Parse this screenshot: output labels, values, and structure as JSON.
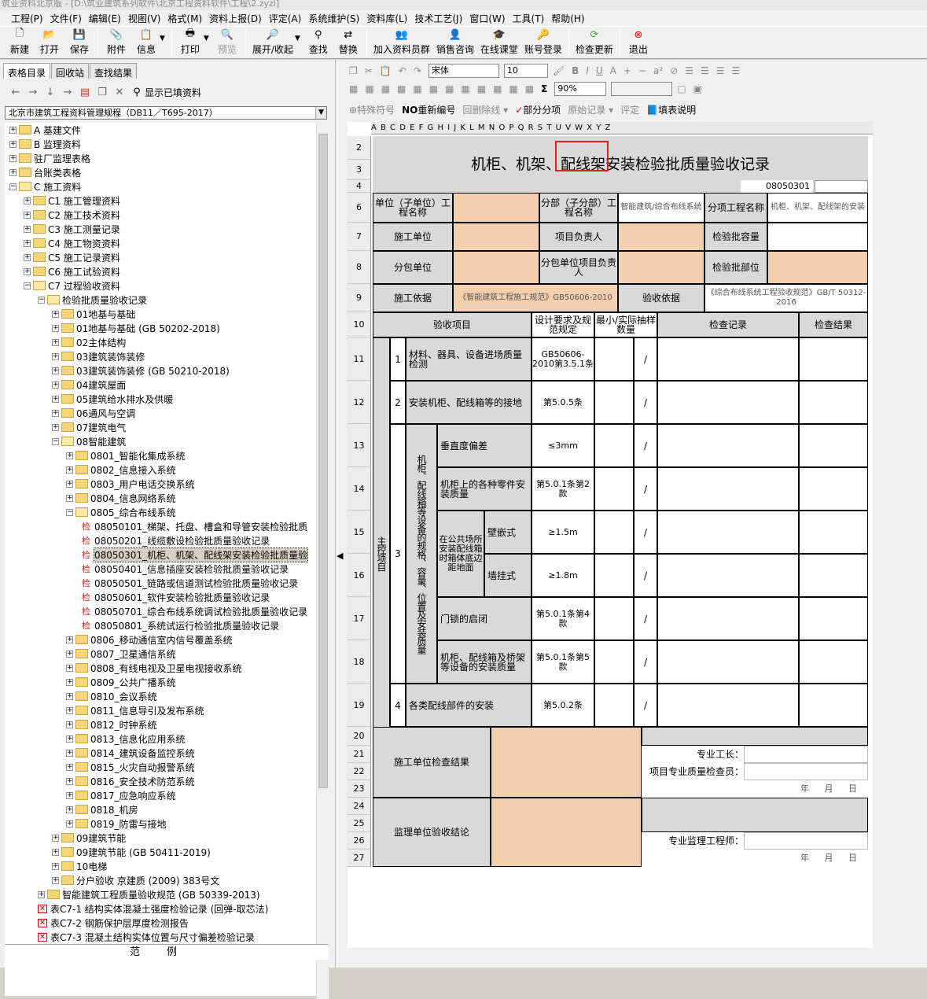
{
  "window_title": "筑业资料北京版 - [D:\\筑业建筑系列软件\\北京工程资料软件\\工程\\2.zyzl]",
  "menu": [
    "工程(P)",
    "文件(F)",
    "编辑(E)",
    "视图(V)",
    "格式(M)",
    "资料上报(D)",
    "评定(A)",
    "系统维护(S)",
    "资料库(L)",
    "技术工艺(J)",
    "窗口(W)",
    "工具(T)",
    "帮助(H)"
  ],
  "toolbar": [
    "新建",
    "打开",
    "保存",
    "附件",
    "信息",
    "打印",
    "预览",
    "展开/收起",
    "查找",
    "替换",
    "加入资料员群",
    "销售咨询",
    "在线课堂",
    "账号登录",
    "检查更新",
    "退出"
  ],
  "left_tabs": [
    "表格目录",
    "回收站",
    "查找结果"
  ],
  "show_filled": "显示已填资料",
  "spec_select": "北京市建筑工程资料管理规程（DB11／T695-2017）",
  "tree": [
    "A 基建文件",
    "B 监理资料",
    "驻厂监理表格",
    "台账类表格",
    "C 施工资料",
    "C1 施工管理资料",
    "C2 施工技术资料",
    "C3 施工测量记录",
    "C4 施工物资资料",
    "C5 施工记录资料",
    "C6 施工试验资料",
    "C7 过程验收资料",
    "检验批质量验收记录",
    "01地基与基础",
    "01地基与基础 (GB 50202-2018)",
    "02主体结构",
    "03建筑装饰装修",
    "03建筑装饰装修 (GB 50210-2018)",
    "04建筑屋面",
    "05建筑给水排水及供暖",
    "06通风与空调",
    "07建筑电气",
    "08智能建筑",
    "0801_智能化集成系统",
    "0802_信息接入系统",
    "0803_用户电话交换系统",
    "0804_信息网络系统",
    "0805_综合布线系统",
    "08050101_梯架、托盘、槽盒和导管安装检验批质",
    "08050201_线缆敷设检验批质量验收记录",
    "08050301_机柜、机架、配线架安装检验批质量验",
    "08050401_信息插座安装检验批质量验收记录",
    "08050501_链路或信道测试检验批质量验收记录",
    "08050601_软件安装检验批质量验收记录",
    "08050701_综合布线系统调试检验批质量验收记录",
    "08050801_系统试运行检验批质量验收记录",
    "0806_移动通信室内信号覆盖系统",
    "0807_卫星通信系统",
    "0808_有线电视及卫星电视接收系统",
    "0809_公共广播系统",
    "0810_会议系统",
    "0811_信息导引及发布系统",
    "0812_时钟系统",
    "0813_信息化应用系统",
    "0814_建筑设备监控系统",
    "0815_火灾自动报警系统",
    "0816_安全技术防范系统",
    "0817_应急响应系统",
    "0818_机房",
    "0819_防雷与接地",
    "09建筑节能",
    "09建筑节能 (GB 50411-2019)",
    "10电梯",
    "分户验收 京建质 (2009) 383号文",
    "智能建筑工程质量验收规范 (GB 50339-2013)",
    "表C7-1 结构实体混凝土强度检验记录 (回弹-取芯法)",
    "表C7-2 钢筋保护层厚度检测报告",
    "表C7-3 混凝土结构实体位置与尺寸偏差检验记录"
  ],
  "legend": "范例",
  "right_toolbar": {
    "font": "宋体",
    "size": "10",
    "zoom": "90%",
    "row3": [
      "特殊符号",
      "重新编号",
      "回删除线",
      "部分分项",
      "原始记录",
      "评定",
      "填表说明"
    ]
  },
  "column_header": "A B C D E F G H I J K L M N O P Q R S T U V W X Y Z",
  "row_numbers": [
    "2",
    "3",
    "4",
    "6",
    "7",
    "8",
    "9",
    "10",
    "11",
    "12",
    "13",
    "14",
    "15",
    "16",
    "17",
    "18",
    "19",
    "20",
    "21",
    "22",
    "23",
    "24",
    "25",
    "26",
    "27"
  ],
  "form": {
    "title": "机柜、机架、配线架安装检验批质量验收记录",
    "code": "08050301",
    "unit_name_label": "单位（子单位）工程名称",
    "sub_project_label": "分部（子分部）工程名称",
    "sub_project_value": "智能建筑/综合布线系统",
    "item_project_label": "分项工程名称",
    "item_project_value": "机柜、机架、配线架的安装",
    "construction_unit": "施工单位",
    "project_manager": "项目负责人",
    "batch_capacity": "检验批容量",
    "subcontract_unit": "分包单位",
    "sub_manager": "分包单位项目负责人",
    "batch_location": "检验批部位",
    "basis_label": "施工依据",
    "basis_value": "《智能建筑工程施工规范》GB50606-2010",
    "acceptance_basis_label": "验收依据",
    "acceptance_basis_value": "《综合布线系统工程验收规范》GB/T 50312-2016",
    "hdr_item": "验收项目",
    "hdr_req": "设计要求及规范规定",
    "hdr_sample": "最小/实际抽样数量",
    "hdr_record": "检查记录",
    "hdr_result": "检查结果",
    "main_items": "主控项目",
    "item3_group": "机柜、配线箱等设备的规格、容量、位置及安装质量",
    "public_space": "在公共场所安装配线箱时箱体底边距地面",
    "rows": [
      {
        "no": "1",
        "name": "材料、器具、设备进场质量检测",
        "req": "GB50606-2010第3.5.1条",
        "sample": "/"
      },
      {
        "no": "2",
        "name": "安装机柜、配线箱等的接地",
        "req": "第5.0.5条",
        "sample": "/"
      },
      {
        "no": "3",
        "name": "垂直度偏差",
        "req": "≤3mm",
        "sample": "/"
      },
      {
        "no": "",
        "name": "机柜上的各种零件安装质量",
        "req": "第5.0.1条第2款",
        "sample": "/"
      },
      {
        "no": "",
        "name": "壁嵌式",
        "req": "≥1.5m",
        "sample": "/"
      },
      {
        "no": "",
        "name": "墙挂式",
        "req": "≥1.8m",
        "sample": "/"
      },
      {
        "no": "",
        "name": "门锁的启闭",
        "req": "第5.0.1条第4款",
        "sample": "/"
      },
      {
        "no": "",
        "name": "机柜、配线箱及桥架等设备的安装质量",
        "req": "第5.0.1条第5款",
        "sample": "/"
      },
      {
        "no": "4",
        "name": "各类配线部件的安装",
        "req": "第5.0.2条",
        "sample": "/"
      }
    ],
    "construction_check": "施工单位检查结果",
    "foreman": "专业工长：",
    "quality_inspector": "项目专业质量检查员：",
    "date": "年 月 日",
    "supervision_conclusion": "监理单位验收结论",
    "supervision_engineer": "专业监理工程师："
  }
}
